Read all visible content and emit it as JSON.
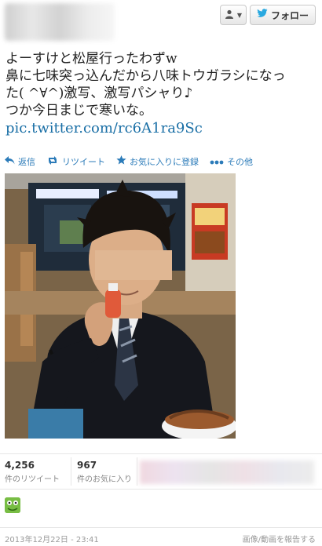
{
  "header": {
    "follow_label": "フォロー"
  },
  "tweet": {
    "lines": [
      "よーすけと松屋行ったわずw",
      "鼻に七味突っ込んだから八味トウガラシになっ",
      "た( ^∀^)激写、激写パシャり♪",
      "つか今日まじで寒いな。"
    ],
    "link": "pic.twitter.com/rc6A1ra9Sc"
  },
  "actions": {
    "reply": "返信",
    "retweet": "リツイート",
    "favorite": "お気に入りに登録",
    "more": "その他"
  },
  "stats": {
    "retweets_count": "4,256",
    "retweets_label": "件のリツイート",
    "favorites_count": "967",
    "favorites_label": "件のお気に入り"
  },
  "footer": {
    "date": "2013年12月22日 - 23:41",
    "report": "画像/動画を報告する"
  },
  "colors": {
    "link": "#1a6fa6",
    "action": "#2b7bb9",
    "twitter_bird": "#2aa9e0"
  }
}
